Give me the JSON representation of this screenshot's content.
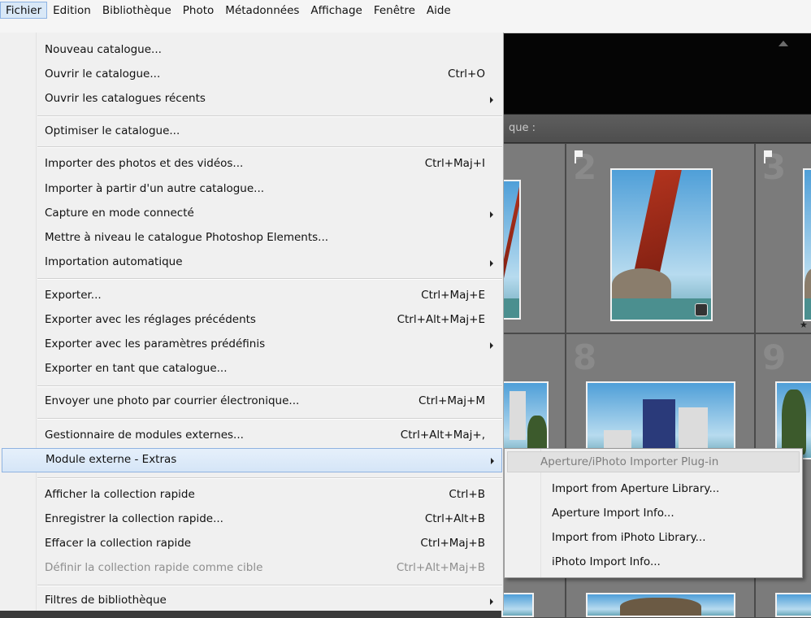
{
  "menubar": {
    "items": [
      "Fichier",
      "Edition",
      "Bibliothèque",
      "Photo",
      "Métadonnées",
      "Affichage",
      "Fenêtre",
      "Aide"
    ]
  },
  "file_menu": {
    "items": [
      {
        "label": "Nouveau catalogue...",
        "shortcut": ""
      },
      {
        "label": "Ouvrir le catalogue...",
        "shortcut": "Ctrl+O"
      },
      {
        "label": "Ouvrir les catalogues récents",
        "shortcut": ""
      },
      {
        "label": "Optimiser le catalogue...",
        "shortcut": ""
      },
      {
        "label": "Importer des photos et des vidéos...",
        "shortcut": "Ctrl+Maj+I"
      },
      {
        "label": "Importer à partir d'un autre catalogue...",
        "shortcut": ""
      },
      {
        "label": "Capture en mode connecté",
        "shortcut": ""
      },
      {
        "label": "Mettre à niveau le catalogue Photoshop Elements...",
        "shortcut": ""
      },
      {
        "label": "Importation automatique",
        "shortcut": ""
      },
      {
        "label": "Exporter...",
        "shortcut": "Ctrl+Maj+E"
      },
      {
        "label": "Exporter avec les réglages précédents",
        "shortcut": "Ctrl+Alt+Maj+E"
      },
      {
        "label": "Exporter avec les paramètres prédéfinis",
        "shortcut": ""
      },
      {
        "label": "Exporter en tant que catalogue...",
        "shortcut": ""
      },
      {
        "label": "Envoyer une photo par courrier électronique...",
        "shortcut": "Ctrl+Maj+M"
      },
      {
        "label": "Gestionnaire de modules externes...",
        "shortcut": "Ctrl+Alt+Maj+,"
      },
      {
        "label": "Module externe - Extras",
        "shortcut": ""
      },
      {
        "label": "Afficher la collection rapide",
        "shortcut": "Ctrl+B"
      },
      {
        "label": "Enregistrer la collection rapide...",
        "shortcut": "Ctrl+Alt+B"
      },
      {
        "label": "Effacer la collection rapide",
        "shortcut": "Ctrl+Maj+B"
      },
      {
        "label": "Définir la collection rapide comme cible",
        "shortcut": "Ctrl+Alt+Maj+B"
      },
      {
        "label": "Filtres de bibliothèque",
        "shortcut": ""
      }
    ]
  },
  "submenu": {
    "header": "Aperture/iPhoto Importer Plug-in",
    "items": [
      "Import from Aperture Library...",
      "Aperture Import Info...",
      "Import from iPhoto Library...",
      "iPhoto Import Info..."
    ]
  },
  "library": {
    "filter_label": "que :",
    "cells": [
      "2",
      "3",
      "8",
      "9"
    ]
  }
}
